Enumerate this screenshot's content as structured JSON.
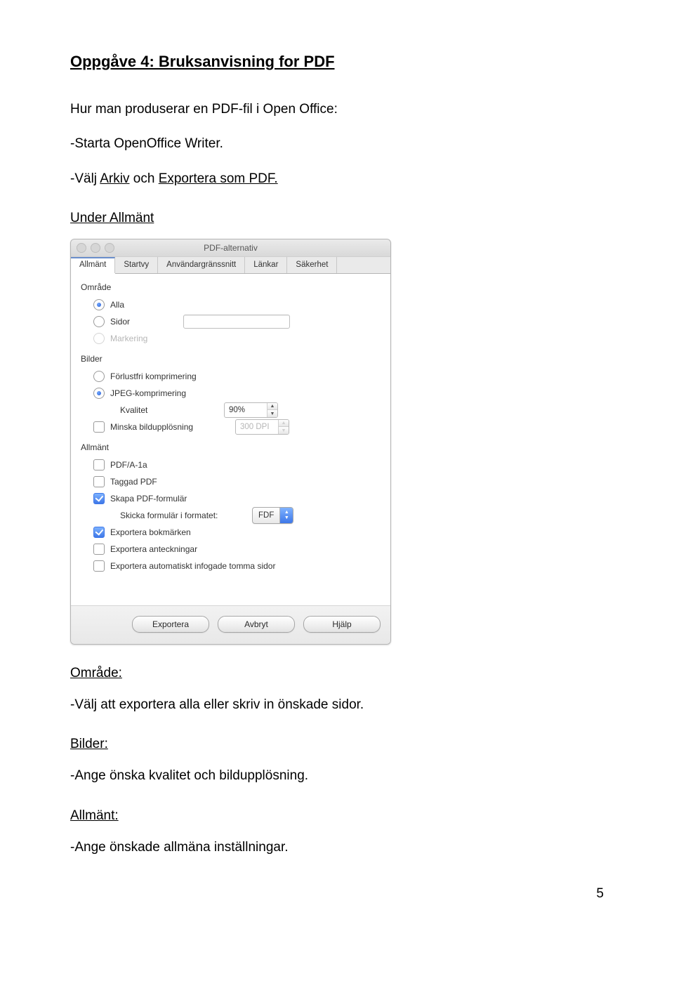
{
  "doc": {
    "title": "Oppgåve 4: Bruksanvisning for PDF",
    "para1": "Hur man produserar en PDF-fil i Open Office:",
    "para2_pre": "-Starta OpenOffice Writer.",
    "para3_pre": "-Välj ",
    "para3_u1": "Arkiv",
    "para3_mid": " och ",
    "para3_u2": "Exportera som PDF.",
    "heading_under": "Under Allmänt",
    "heading_omrade": "Område:",
    "p_omrade": "-Välj att exportera alla eller skriv in önskade sidor.",
    "heading_bilder": "Bilder:",
    "p_bilder": "-Ange önska kvalitet och bildupplösning.",
    "heading_allmant": "Allmänt:",
    "p_allmant": "-Ange önskade allmäna inställningar.",
    "page_number": "5"
  },
  "dialog": {
    "window_title": "PDF-alternativ",
    "tabs": [
      "Allmänt",
      "Startvy",
      "Användargränssnitt",
      "Länkar",
      "Säkerhet"
    ],
    "tab_active": "Allmänt",
    "group_omrade": "Område",
    "radio_alla": "Alla",
    "radio_sidor": "Sidor",
    "radio_markering": "Markering",
    "group_bilder": "Bilder",
    "radio_lossless": "Förlustfri komprimering",
    "radio_jpeg": "JPEG-komprimering",
    "label_kvalitet": "Kvalitet",
    "value_kvalitet": "90%",
    "chk_minska": "Minska bildupplösning",
    "value_dpi": "300 DPI",
    "group_allmant": "Allmänt",
    "chk_pdfa": "PDF/A-1a",
    "chk_taggad": "Taggad PDF",
    "chk_formular": "Skapa PDF-formulär",
    "label_format": "Skicka formulär i formatet:",
    "value_format": "FDF",
    "chk_bookmarks": "Exportera bokmärken",
    "chk_notes": "Exportera anteckningar",
    "chk_blank": "Exportera automatiskt infogade tomma sidor",
    "btn_export": "Exportera",
    "btn_cancel": "Avbryt",
    "btn_help": "Hjälp"
  }
}
